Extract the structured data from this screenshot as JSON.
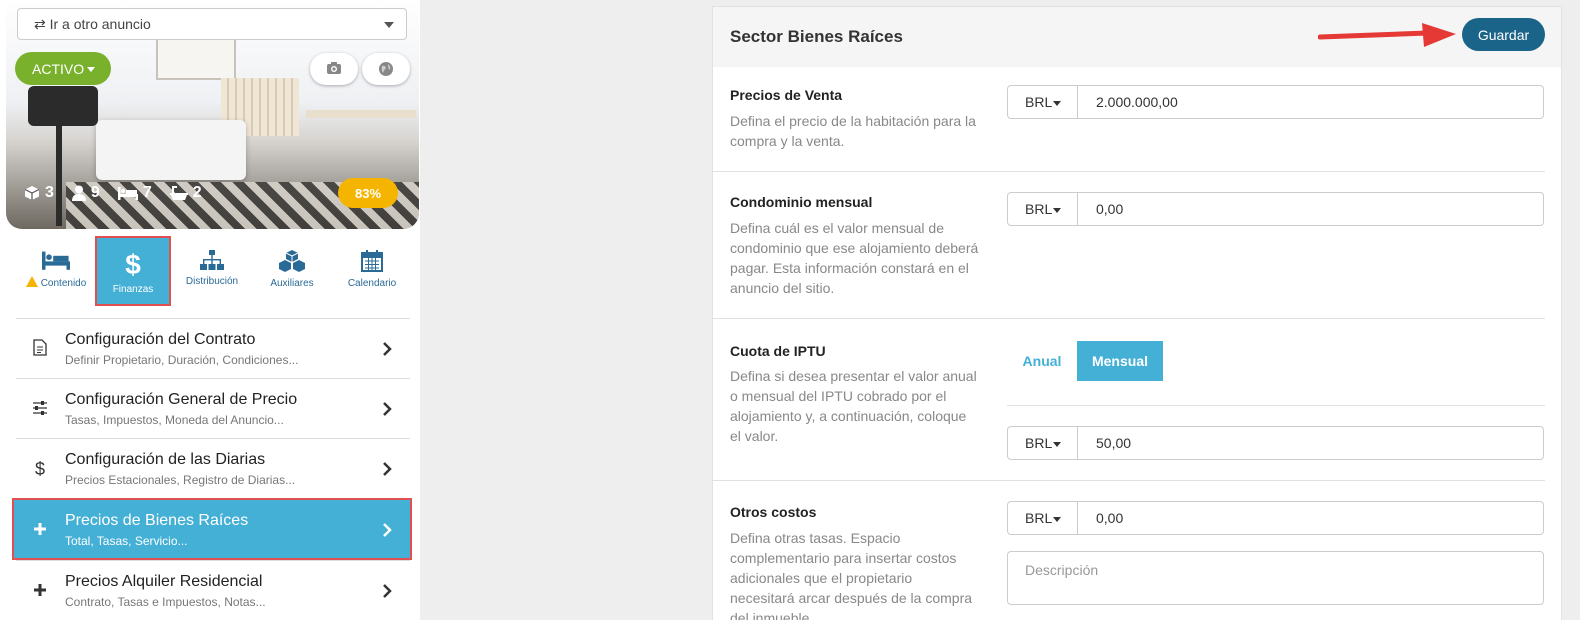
{
  "listing": {
    "goto_label": "⇄ Ir a otro anuncio",
    "status_label": "ACTIVO",
    "stats": {
      "units": "3",
      "guests": "9",
      "beds": "7",
      "baths": "2"
    },
    "completion": "83%"
  },
  "tabs": [
    {
      "label": "Contenido",
      "icon": "bed-icon"
    },
    {
      "label": "Finanzas",
      "icon": "dollar-icon"
    },
    {
      "label": "Distribución",
      "icon": "sitemap-icon"
    },
    {
      "label": "Auxiliares",
      "icon": "cubes-icon"
    },
    {
      "label": "Calendario",
      "icon": "calendar-icon"
    }
  ],
  "menu": [
    {
      "title": "Configuración del Contrato",
      "subtitle": "Definir Propietario, Duración, Condiciones...",
      "icon": "document-icon"
    },
    {
      "title": "Configuración General de Precio",
      "subtitle": "Tasas, Impuestos, Moneda del Anuncio...",
      "icon": "sliders-icon"
    },
    {
      "title": "Configuración de las Diarias",
      "subtitle": "Precios Estacionales, Registro de Diarias...",
      "icon": "dollar-icon"
    },
    {
      "title": "Precios de Bienes Raíces",
      "subtitle": "Total, Tasas, Servicio...",
      "icon": "plus-icon"
    },
    {
      "title": "Precios Alquiler Residencial",
      "subtitle": "Contrato, Tasas e Impuestos, Notas...",
      "icon": "plus-icon"
    }
  ],
  "panel": {
    "title": "Sector Bienes Raíces",
    "save_label": "Guardar",
    "sections": {
      "venta": {
        "title": "Precios de Venta",
        "desc": "Defina el precio de la habitación para la compra y la venta.",
        "currency": "BRL",
        "value": "2.000.000,00"
      },
      "condominio": {
        "title": "Condominio mensual",
        "desc": "Defina cuál es el valor mensual de condominio que ese alojamiento deberá pagar. Esta información constará en el anuncio del sitio.",
        "currency": "BRL",
        "value": "0,00"
      },
      "iptu": {
        "title": "Cuota de IPTU",
        "desc": "Defina si desea presentar el valor anual o mensual del IPTU cobrado por el alojamiento y, a continuación, coloque el valor.",
        "option_annual": "Anual",
        "option_monthly": "Mensual",
        "currency": "BRL",
        "value": "50,00"
      },
      "otros": {
        "title": "Otros costos",
        "desc": "Defina otras tasas. Espacio complementario para insertar costos adicionales que el propietario necesitará arcar después de la compra del inmueble.",
        "currency": "BRL",
        "value": "0,00",
        "description_placeholder": "Descripción"
      }
    }
  },
  "colors": {
    "accent": "#45b0d6",
    "save": "#1a6489",
    "active_status": "#79b12c",
    "badge": "#f5b400",
    "highlight_border": "#e05050"
  }
}
